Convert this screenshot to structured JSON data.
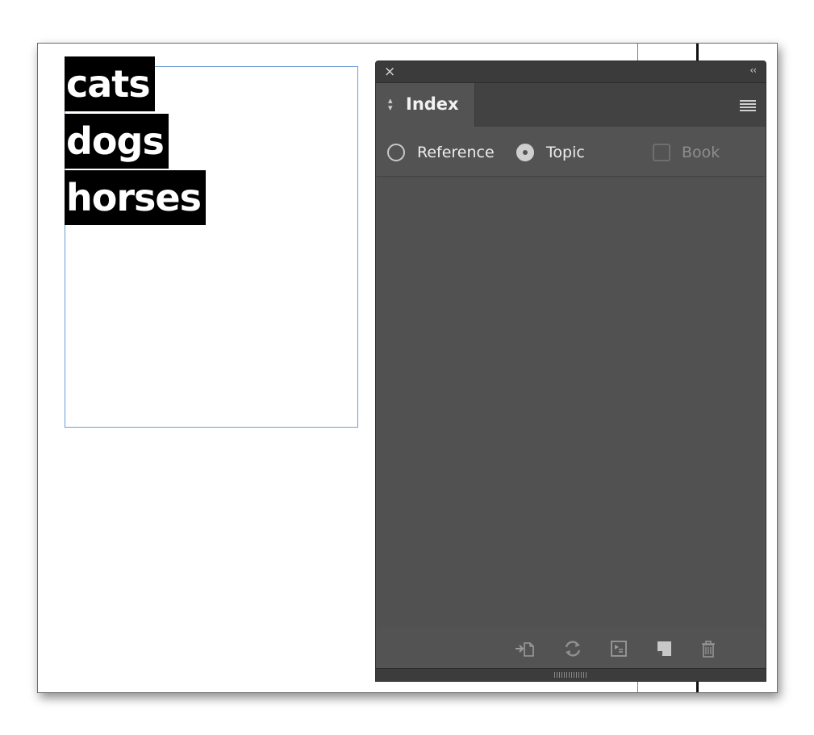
{
  "document": {
    "words": [
      "cats",
      "dogs",
      "horses"
    ]
  },
  "panel": {
    "close_icon": "×",
    "collapse_icon": "‹‹",
    "tab_label": "Index",
    "options": {
      "reference_label": "Reference",
      "topic_label": "Topic",
      "book_label": "Book",
      "selected": "Topic",
      "book_checked": false,
      "book_enabled": false
    },
    "entries": [],
    "footer_icons": [
      "go-to-selected-marker-icon",
      "refresh-icon",
      "generate-index-icon",
      "new-entry-icon",
      "delete-icon"
    ]
  }
}
